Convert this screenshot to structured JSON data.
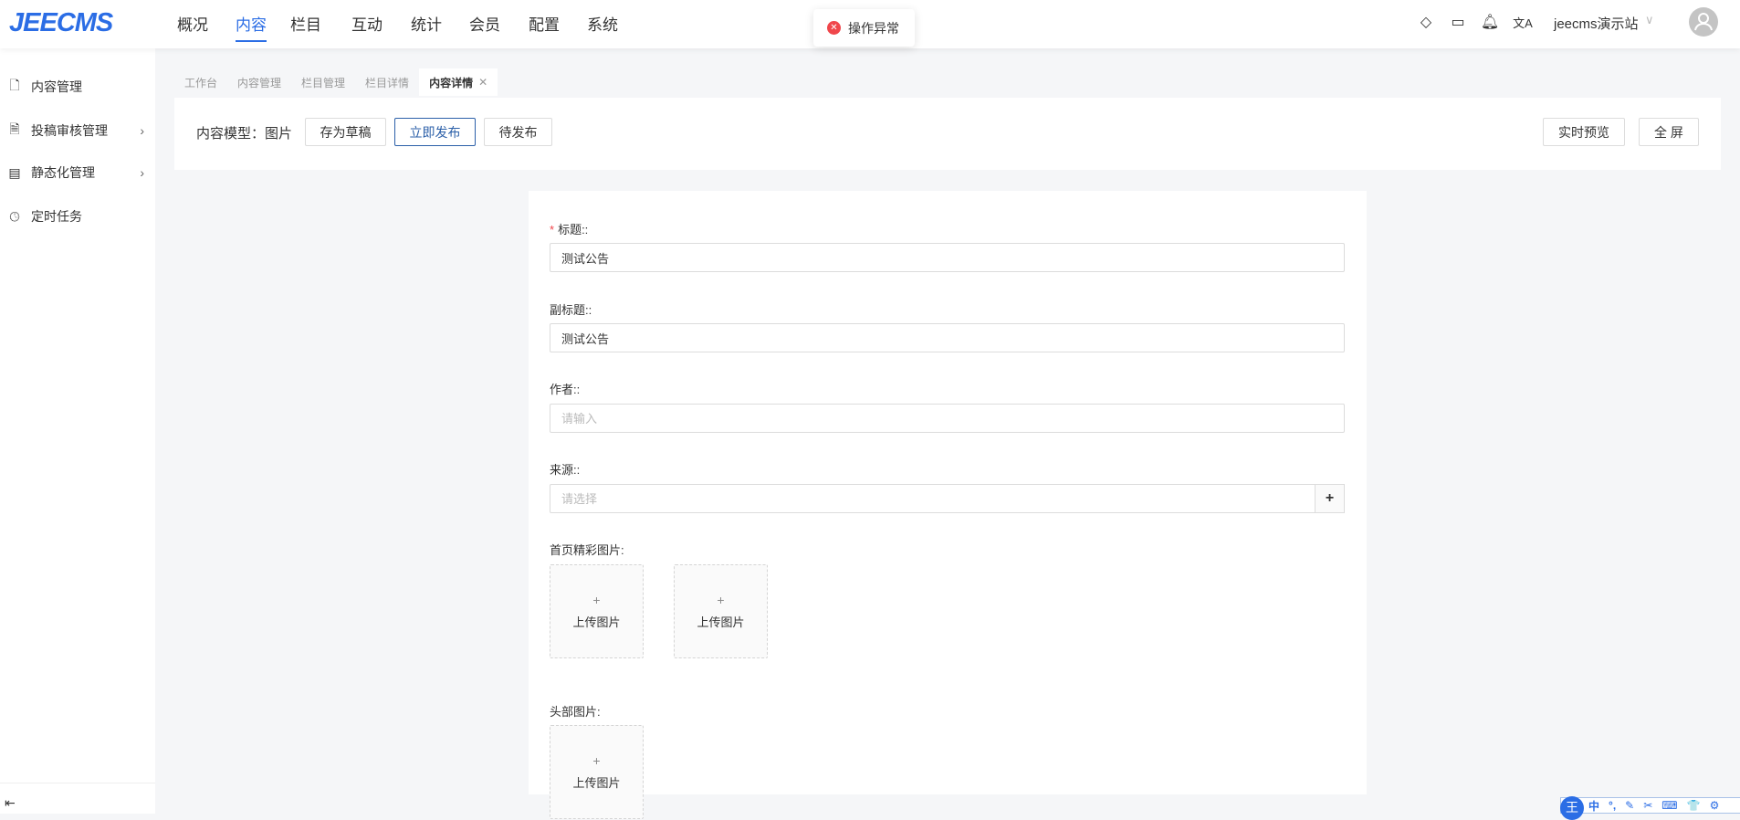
{
  "header": {
    "logo": "JEECMS",
    "nav": [
      "概况",
      "内容",
      "栏目",
      "互动",
      "统计",
      "会员",
      "配置",
      "系统"
    ],
    "active_nav": "内容",
    "site": "jeecms演示站",
    "icons": [
      "paint-bucket-icon",
      "monitor-icon",
      "bell-icon",
      "translate-icon"
    ]
  },
  "toast": {
    "message": "操作异常",
    "type": "error"
  },
  "sidebar": {
    "items": [
      {
        "label": "内容管理",
        "icon": "document-icon"
      },
      {
        "label": "投稿审核管理",
        "icon": "audit-icon"
      },
      {
        "label": "静态化管理",
        "icon": "static-icon"
      },
      {
        "label": "定时任务",
        "icon": "clock-icon"
      }
    ]
  },
  "tabs": [
    "工作台",
    "内容管理",
    "栏目管理",
    "栏目详情",
    "内容详情"
  ],
  "toolbar": {
    "model": "内容模型：图片",
    "save_draft": "存为草稿",
    "publish_now": "立即发布",
    "pending_publish": "待发布",
    "live_preview": "实时预览",
    "fullscreen": "全 屏"
  },
  "form": {
    "title_label": "标题::",
    "title_value": "测试公告",
    "subtitle_label": "副标题::",
    "subtitle_value": "测试公告",
    "author_label": "作者::",
    "author_placeholder": "请输入",
    "source_label": "来源::",
    "source_placeholder": "请选择",
    "home_image_label": "首页精彩图片:",
    "head_image_label": "头部图片:",
    "upload_label": "上传图片",
    "plus": "+"
  },
  "ime": {
    "logo": "王",
    "mode": "中",
    "items": [
      "°,",
      "✎",
      "✂",
      "⌨",
      "👕",
      "⚙"
    ]
  },
  "colors": {
    "accent": "#2b6de5",
    "error": "#f0464b"
  }
}
